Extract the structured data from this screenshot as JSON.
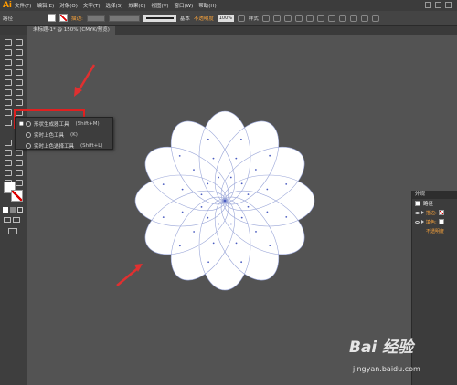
{
  "app": {
    "logo": "Ai"
  },
  "menu": {
    "items": [
      "文件(F)",
      "编辑(E)",
      "对象(O)",
      "文字(T)",
      "选择(S)",
      "效果(C)",
      "视图(V)",
      "窗口(W)",
      "帮助(H)"
    ]
  },
  "control_bar": {
    "object_label": "路径",
    "stroke_label": "描边:",
    "brush_label": "基本",
    "opacity_label": "不透明度",
    "opacity_value": "100%",
    "style_label": "样式"
  },
  "document_tab": {
    "title": "未标题-1* @ 150% (CMYK/预览)"
  },
  "flyout": {
    "items": [
      {
        "label": "形状生成器工具",
        "shortcut": "(Shift+M)",
        "checked": true
      },
      {
        "label": "实时上色工具",
        "shortcut": "(K)",
        "checked": false
      },
      {
        "label": "实时上色选择工具",
        "shortcut": "(Shift+L)",
        "checked": false
      }
    ]
  },
  "appearance_panel": {
    "tab": "外观",
    "title": "路径",
    "rows": [
      {
        "label": "描边:"
      },
      {
        "label": "填色:"
      },
      {
        "label": "不透明度"
      }
    ]
  },
  "watermark": {
    "logo": "Bai  经验",
    "url": "jingyan.baidu.com"
  },
  "colors": {
    "accent": "#f7a23b",
    "highlight_box": "#e02020",
    "arrow": "#e03030",
    "path": "#9aa6d8"
  }
}
